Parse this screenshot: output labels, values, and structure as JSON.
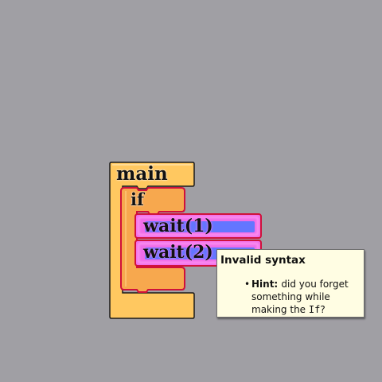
{
  "blocks": {
    "main": {
      "label": "main"
    },
    "if_block": {
      "label": "if"
    },
    "wait_1": {
      "label": "wait(1)"
    },
    "wait_2": {
      "label": "wait(2)"
    }
  },
  "tooltip": {
    "title": "Invalid syntax",
    "bullet": "•",
    "hint_label": "Hint:",
    "hint_text": "did you forget something while making the",
    "hint_code": "If",
    "hint_end": "?"
  },
  "colors": {
    "background": "#a09fa4",
    "block_orange": "#ffc860",
    "block_orange_dark": "#f4a340",
    "error_red": "#d0103a",
    "wait_magenta": "#f06ce8",
    "wait_blue": "#6476ff",
    "tooltip_bg": "#fffde3"
  }
}
